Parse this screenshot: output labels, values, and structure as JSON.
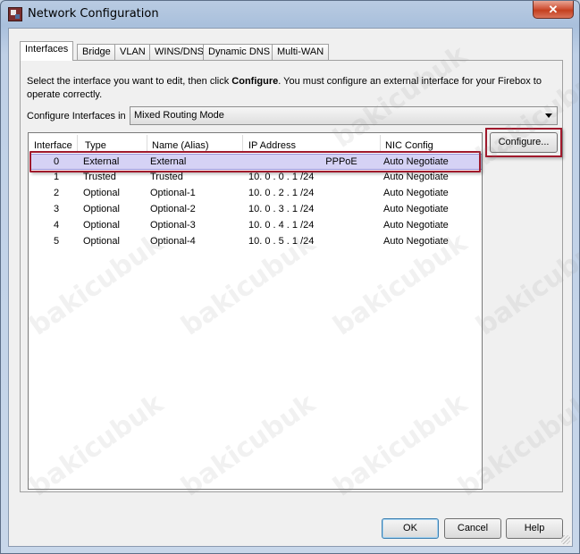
{
  "window": {
    "title": "Network Configuration",
    "close_glyph": "✕"
  },
  "tabs": [
    {
      "label": "Interfaces",
      "active": true
    },
    {
      "label": "Bridge"
    },
    {
      "label": "VLAN"
    },
    {
      "label": "WINS/DNS"
    },
    {
      "label": "Dynamic DNS"
    },
    {
      "label": "Multi-WAN"
    }
  ],
  "instructions": {
    "part1": "Select the interface you want to edit, then click ",
    "bold": "Configure",
    "part2": ". You must configure an external interface for your Firebox to operate correctly."
  },
  "mode": {
    "label": "Configure Interfaces in",
    "value": "Mixed Routing Mode"
  },
  "table": {
    "headers": [
      "Interface",
      "Type",
      "Name (Alias)",
      "IP Address",
      "NIC Config"
    ],
    "rows": [
      [
        "0",
        "External",
        "External",
        "PPPoE",
        "Auto Negotiate"
      ],
      [
        "1",
        "Trusted",
        "Trusted",
        "10. 0 . 0 . 1 /24",
        "Auto Negotiate"
      ],
      [
        "2",
        "Optional",
        "Optional-1",
        "10. 0 . 2 . 1 /24",
        "Auto Negotiate"
      ],
      [
        "3",
        "Optional",
        "Optional-2",
        "10. 0 . 3 . 1 /24",
        "Auto Negotiate"
      ],
      [
        "4",
        "Optional",
        "Optional-3",
        "10. 0 . 4 . 1 /24",
        "Auto Negotiate"
      ],
      [
        "5",
        "Optional",
        "Optional-4",
        "10. 0 . 5 . 1 /24",
        "Auto Negotiate"
      ]
    ]
  },
  "buttons": {
    "configure": "Configure...",
    "ok": "OK",
    "cancel": "Cancel",
    "help": "Help"
  },
  "watermark": "bakicubuk",
  "colors": {
    "highlight_outline": "#a0192c",
    "selected_row": "#d5d2f5"
  }
}
